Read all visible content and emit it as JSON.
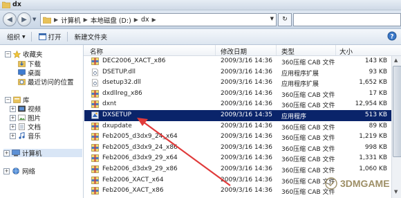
{
  "window": {
    "title": "dx"
  },
  "address": {
    "segments": [
      "计算机",
      "本地磁盘 (D:)",
      "dx"
    ]
  },
  "toolbar": {
    "organize": "组织",
    "open": "打开",
    "new_folder": "新建文件夹"
  },
  "nav": {
    "favorites": "收藏夹",
    "downloads": "下载",
    "desktop": "桌面",
    "recent": "最近访问的位置",
    "libraries": "库",
    "videos": "视频",
    "pictures": "图片",
    "documents": "文档",
    "music": "音乐",
    "computer": "计算机",
    "network": "网络"
  },
  "columns": {
    "name": "名称",
    "date": "修改日期",
    "type": "类型",
    "size": "大小"
  },
  "files": [
    {
      "name": "DEC2006_XACT_x86",
      "date": "2009/3/16 14:36",
      "type": "360压缩 CAB 文件",
      "size": "143 KB",
      "icon": "cab-icon"
    },
    {
      "name": "DSETUP.dll",
      "date": "2009/3/16 14:36",
      "type": "应用程序扩展",
      "size": "93 KB",
      "icon": "dll-icon"
    },
    {
      "name": "dsetup32.dll",
      "date": "2009/3/16 14:36",
      "type": "应用程序扩展",
      "size": "1,652 KB",
      "icon": "dll-icon"
    },
    {
      "name": "dxdllreg_x86",
      "date": "2009/3/16 14:36",
      "type": "360压缩 CAB 文件",
      "size": "17 KB",
      "icon": "cab-icon"
    },
    {
      "name": "dxnt",
      "date": "2009/3/16 14:36",
      "type": "360压缩 CAB 文件",
      "size": "12,954 KB",
      "icon": "cab-icon"
    },
    {
      "name": "DXSETUP",
      "date": "2009/3/16 14:35",
      "type": "应用程序",
      "size": "513 KB",
      "icon": "setup-exe-icon"
    },
    {
      "name": "dxupdate",
      "date": "2009/3/16 14:36",
      "type": "360压缩 CAB 文件",
      "size": "89 KB",
      "icon": "cab-icon"
    },
    {
      "name": "Feb2005_d3dx9_24_x64",
      "date": "2009/3/16 14:36",
      "type": "360压缩 CAB 文件",
      "size": "1,219 KB",
      "icon": "cab-icon"
    },
    {
      "name": "Feb2005_d3dx9_24_x86",
      "date": "2009/3/16 14:36",
      "type": "360压缩 CAB 文件",
      "size": "998 KB",
      "icon": "cab-icon"
    },
    {
      "name": "Feb2006_d3dx9_29_x64",
      "date": "2009/3/16 14:36",
      "type": "360压缩 CAB 文件",
      "size": "1,331 KB",
      "icon": "cab-icon"
    },
    {
      "name": "Feb2006_d3dx9_29_x86",
      "date": "2009/3/16 14:36",
      "type": "360压缩 CAB 文件",
      "size": "1,060 KB",
      "icon": "cab-icon"
    },
    {
      "name": "Feb2006_XACT_x64",
      "date": "2009/3/16 14:36",
      "type": "360压缩 CAB 文件",
      "size": "",
      "icon": "cab-icon"
    },
    {
      "name": "Feb2006_XACT_x86",
      "date": "2009/3/16 14:36",
      "type": "360压缩 CAB 文件",
      "size": "",
      "icon": "cab-icon"
    }
  ],
  "selected_file": "DXSETUP",
  "watermark": {
    "text": "3DMGAME"
  },
  "colors": {
    "selection": "#0a246a",
    "annotation_arrow": "#e03a3a"
  }
}
